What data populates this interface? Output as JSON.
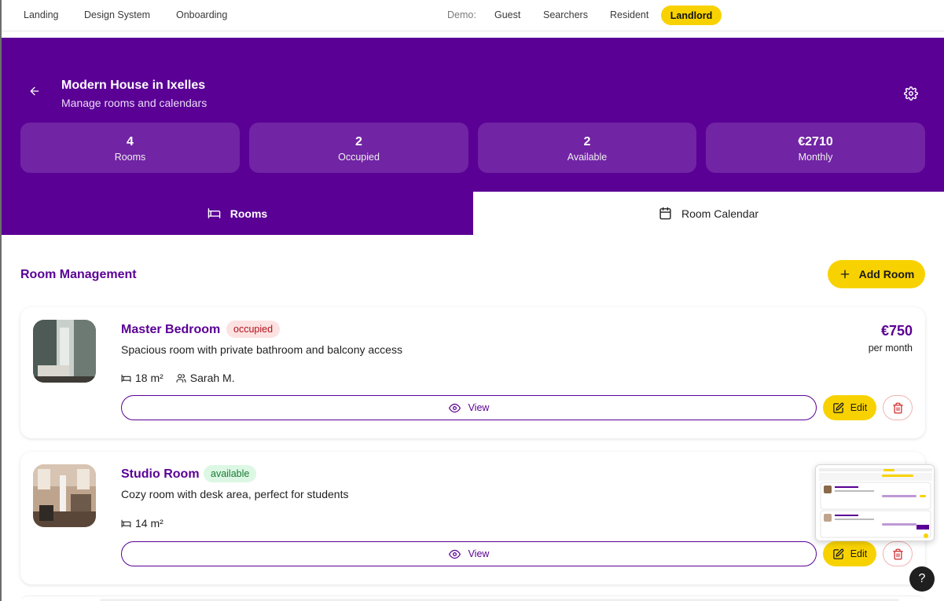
{
  "nav": {
    "links": [
      "Landing",
      "Design System",
      "Onboarding"
    ],
    "demo_label": "Demo:",
    "roles": [
      "Guest",
      "Searchers",
      "Resident"
    ],
    "active_role": "Landlord"
  },
  "header": {
    "title": "Modern House in Ixelles",
    "subtitle": "Manage rooms and calendars",
    "stats": [
      {
        "value": "4",
        "label": "Rooms"
      },
      {
        "value": "2",
        "label": "Occupied"
      },
      {
        "value": "2",
        "label": "Available"
      },
      {
        "value": "€2710",
        "label": "Monthly"
      }
    ]
  },
  "tabs": {
    "rooms": "Rooms",
    "calendar": "Room Calendar"
  },
  "section": {
    "title": "Room Management",
    "add_label": "Add Room"
  },
  "rooms": [
    {
      "name": "Master Bedroom",
      "status": "occupied",
      "description": "Spacious room with private bathroom and balcony access",
      "size": "18 m²",
      "tenant": "Sarah M.",
      "price": "€750",
      "period": "per month",
      "view_label": "View",
      "edit_label": "Edit"
    },
    {
      "name": "Studio Room",
      "status": "available",
      "description": "Cozy room with desk area, perfect for students",
      "size": "14 m²",
      "view_label": "View",
      "edit_label": "Edit"
    }
  ],
  "help_label": "?",
  "colors": {
    "brand_purple": "#5a0095",
    "accent_yellow": "#f8d200",
    "occupied_bg": "#fde2e2",
    "available_bg": "#dcf7e3"
  }
}
